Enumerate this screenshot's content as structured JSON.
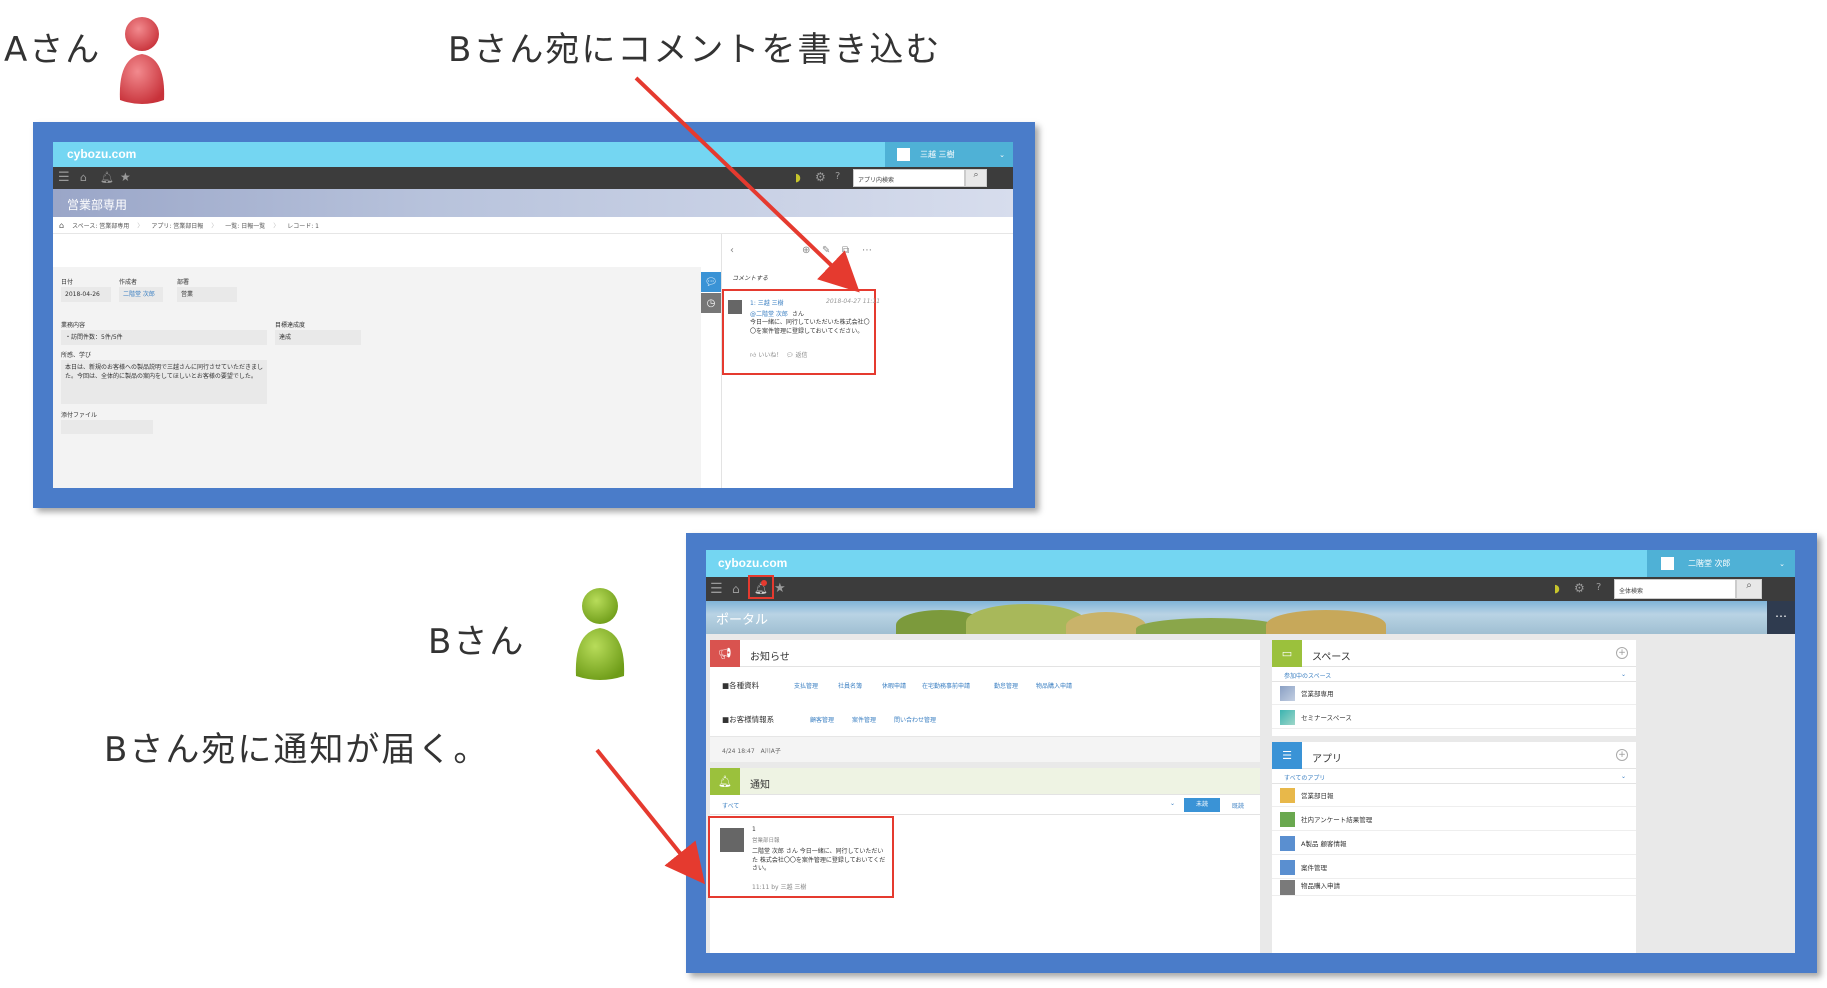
{
  "annotations": {
    "person_a_label": "Aさん",
    "step1_caption": "Bさん宛にコメントを書き込む",
    "person_b_label": "Bさん",
    "step2_caption": "Bさん宛に通知が届く。"
  },
  "colors": {
    "accent_red": "#e53a2f",
    "header_cyan": "#74d6f2",
    "frame_blue": "#4a7cc9",
    "person_a": "#d9434a",
    "person_b": "#88b82a"
  },
  "screen1": {
    "logo": "cybozu.com",
    "user_name": "三越 三樹",
    "search_placeholder": "アプリ内検索",
    "space_title": "営業部専用",
    "breadcrumb": [
      "スペース: 営業部専用",
      "アプリ: 営業部日報",
      "一覧: 日報一覧",
      "レコード: 1"
    ],
    "fields": {
      "date_label": "日付",
      "date_value": "2018-04-26",
      "author_label": "作成者",
      "author_value": "二階堂 次郎",
      "dept_label": "部署",
      "dept_value": "営業",
      "work_label": "業務内容",
      "work_value": "・訪問件数：5件/5件",
      "goal_label": "目標達成度",
      "goal_value": "達成",
      "notes_label": "所感、学び",
      "notes_value": "本日は、新規のお客様への製品説明で三越さんに同行させていただきました。今回は、全体的に製品の案内をしてほしいとお客様の要望でした。",
      "attach_label": "添付ファイル"
    },
    "comment_prompt": "コメントする",
    "comment": {
      "header": "1: 三越 三樹",
      "timestamp": "2018-04-27 11:11",
      "mention": "@二階堂 次郎",
      "mention_suffix": "さん",
      "body": "今日一緒に、同行していただいた株式会社〇〇を案件管理に登録しておいてください。",
      "like": "いいね！",
      "reply": "返信"
    }
  },
  "screen2": {
    "logo": "cybozu.com",
    "user_name": "二階堂 次郎",
    "search_placeholder": "全体検索",
    "portal_title": "ポータル",
    "notice": {
      "title": "お知らせ",
      "row1_label": "■各種資料",
      "row1_links": [
        "支払管理",
        "社員名簿",
        "休暇申請",
        "在宅勤務事前申請",
        "勤怠管理",
        "物品購入申請"
      ],
      "row2_label": "■お客様情報系",
      "row2_links": [
        "顧客管理",
        "案件管理",
        "問い合わせ管理"
      ],
      "footer": "4/24 18:47　A川A子"
    },
    "notifications": {
      "title": "通知",
      "filter": "すべて",
      "unread_button": "未読",
      "read_link": "既読",
      "item": {
        "number": "1",
        "app": "営業部日報",
        "text": "二階堂 次郎 さん 今日一緒に、同行していただいた 株式会社〇〇を案件管理に登録しておいてください。",
        "meta": "11:11  by 三越 三樹"
      }
    },
    "spaces": {
      "title": "スペース",
      "subhead": "参加中のスペース",
      "items": [
        "営業部専用",
        "セミナースペース"
      ]
    },
    "apps": {
      "title": "アプリ",
      "subhead": "すべてのアプリ",
      "items": [
        "営業部日報",
        "社内アンケート結果管理",
        "A製品 顧客情報",
        "案件管理",
        "物品購入申請"
      ]
    }
  }
}
